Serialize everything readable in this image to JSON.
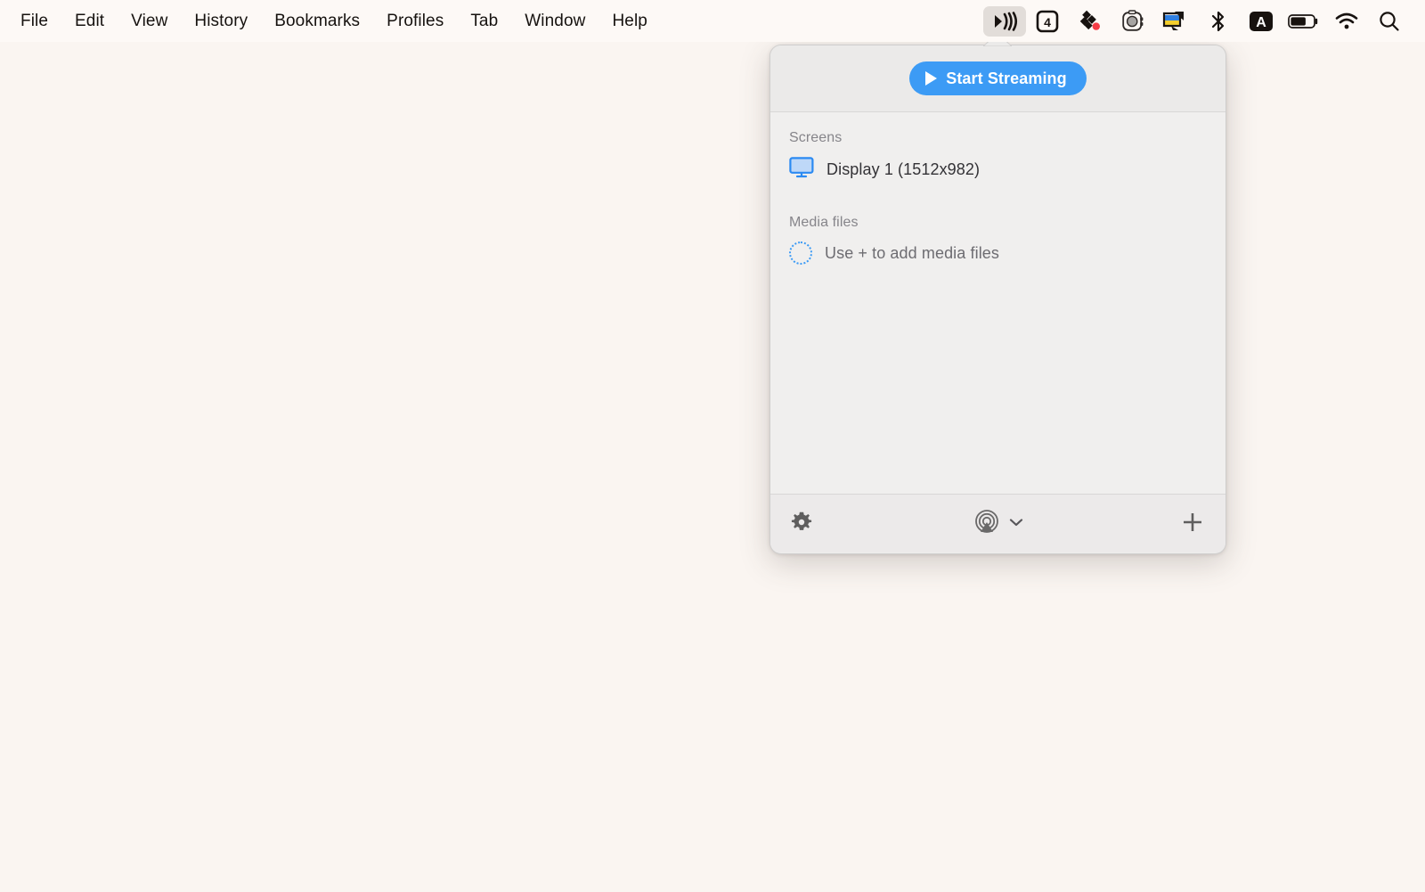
{
  "menubar": {
    "items": [
      {
        "label": "File",
        "name": "menu-file"
      },
      {
        "label": "Edit",
        "name": "menu-edit"
      },
      {
        "label": "View",
        "name": "menu-view"
      },
      {
        "label": "History",
        "name": "menu-history"
      },
      {
        "label": "Bookmarks",
        "name": "menu-bookmarks"
      },
      {
        "label": "Profiles",
        "name": "menu-profiles"
      },
      {
        "label": "Tab",
        "name": "menu-tab"
      },
      {
        "label": "Window",
        "name": "menu-window"
      },
      {
        "label": "Help",
        "name": "menu-help"
      }
    ],
    "status_icons": [
      {
        "name": "streaming-broadcast-icon",
        "active": true
      },
      {
        "name": "numbered-badge-4-icon",
        "value": "4",
        "active": false
      },
      {
        "name": "dropbox-icon",
        "active": false
      },
      {
        "name": "camera-recorder-icon",
        "active": false
      },
      {
        "name": "display-ukraine-flag-icon",
        "active": false
      },
      {
        "name": "bluetooth-icon",
        "active": false
      },
      {
        "name": "input-source-a-icon",
        "value": "A",
        "active": false
      },
      {
        "name": "battery-icon",
        "level": 60,
        "active": false
      },
      {
        "name": "wifi-icon",
        "active": false
      },
      {
        "name": "spotlight-search-icon",
        "active": false
      }
    ]
  },
  "popover": {
    "header": {
      "start_button_label": "Start Streaming"
    },
    "sections": [
      {
        "title": "Screens",
        "rows": [
          {
            "label": "Display 1 (1512x982)",
            "icon": "monitor-icon",
            "muted": false
          }
        ]
      },
      {
        "title": "Media files",
        "rows": [
          {
            "label": "Use + to add media files",
            "icon": "dashed-circle-placeholder-icon",
            "muted": true
          }
        ]
      }
    ],
    "footer": {
      "settings_name": "gear-icon",
      "airplay_name": "airplay-broadcast-icon",
      "chevron_name": "chevron-down-icon",
      "add_name": "plus-icon"
    }
  },
  "colors": {
    "accent_blue": "#3c9bf5",
    "desktop_background": "#faf5f1",
    "menubar_background": "#fdf9f6",
    "popover_background": "#f0efee"
  }
}
